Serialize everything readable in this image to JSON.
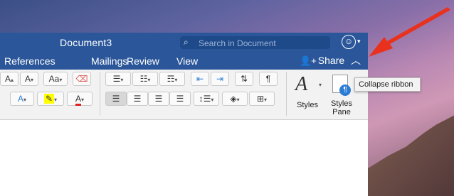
{
  "window": {
    "title": "Document3"
  },
  "search": {
    "placeholder": "Search in Document"
  },
  "tabs": [
    "References",
    "Mailings",
    "Review",
    "View"
  ],
  "share": {
    "label": "Share"
  },
  "ribbon": {
    "font_group": {
      "grow": "A",
      "shrink": "A",
      "change_case": "Aa"
    },
    "styles": {
      "label": "Styles"
    },
    "styles_pane": {
      "label_line1": "Styles",
      "label_line2": "Pane"
    }
  },
  "tooltip": {
    "text": "Collapse ribbon"
  },
  "colors": {
    "accent": "#2b579a",
    "arrow": "#e8321e",
    "highlight": "#ffff00",
    "font_color": "#e02020"
  }
}
